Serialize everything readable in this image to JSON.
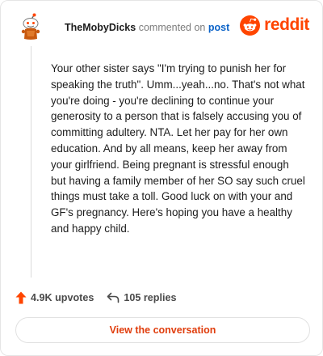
{
  "comment": {
    "username": "TheMobyDicks",
    "action_text": "commented on",
    "post_link": "post",
    "body": "Your other sister says \"I'm trying to punish her for speaking the truth\". Umm...yeah...no. That's not what you're doing - you're declining to continue your generosity to a person that is falsely accusing you of committing adultery. NTA. Let her pay for her own education. And by all means, keep her away from your girlfriend. Being pregnant is stressful enough but having a family member of her SO say such cruel things must take a toll. Good luck on with your and GF's pregnancy. Here's hoping you have a healthy and happy child.",
    "upvotes_label": "4.9K upvotes",
    "replies_label": "105 replies"
  },
  "brand": {
    "wordmark": "reddit",
    "color": "#ff4500"
  },
  "footer": {
    "view_button_label": "View the conversation"
  },
  "icons": {
    "avatar": "snoo-avatar-icon",
    "brand": "reddit-logo-icon",
    "upvote": "upvote-arrow-icon",
    "reply": "reply-arrow-icon"
  }
}
